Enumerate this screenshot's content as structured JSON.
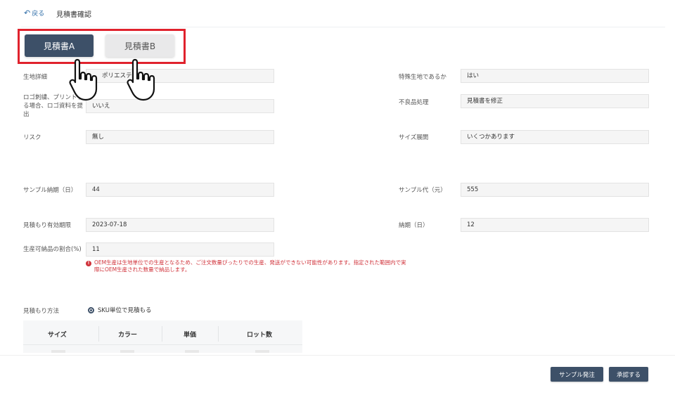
{
  "header": {
    "back_icon": "undo-arrow-icon",
    "back_label": "戻る",
    "title": "見積書確認"
  },
  "tabs": [
    {
      "label": "見積書A",
      "active": true
    },
    {
      "label": "見積書B",
      "active": false
    }
  ],
  "annotation": {
    "highlight_color": "#e0222d",
    "pointer_icon": "pointing-hand-icon"
  },
  "form": {
    "left": [
      {
        "label": "生地詳細",
        "value": "ポリエステル"
      },
      {
        "label": "ロゴ刺繍、プリントする場合、ロゴ資料を提出",
        "value": "いいえ"
      },
      {
        "label": "リスク",
        "value": "無し"
      },
      {
        "label": "サンプル納期（日）",
        "value": "44"
      },
      {
        "label": "見積もり有効期限",
        "value": "2023-07-18"
      },
      {
        "label": "生産可納品の割合(%)",
        "value": "11"
      }
    ],
    "right": [
      {
        "label": "特殊生地であるか",
        "value": "はい"
      },
      {
        "label": "不良品処理",
        "value": "見積書を修正"
      },
      {
        "label": "サイズ展開",
        "value": "いくつかあります"
      },
      {
        "label": "サンプル代（元）",
        "value": "555"
      },
      {
        "label": "納期（日）",
        "value": "12"
      }
    ],
    "warning": "OEM生産は生地単位での生産となるため、ご注文数量ぴったりでの生産、発送ができない可能性があります。指定された範囲内で実際にOEM生産された数量で納品します。",
    "warning_icon": "exclamation-circle-icon"
  },
  "estimate_method": {
    "label": "見積もり方法",
    "option": "SKU単位で見積もる",
    "selected": true
  },
  "table": {
    "headers": [
      "サイズ",
      "カラー",
      "単価",
      "ロット数"
    ]
  },
  "footer": {
    "sample_order_label": "サンプル発注",
    "approve_label": "承認する"
  },
  "colors": {
    "primary": "#3d5068",
    "link": "#2f6ea8",
    "warning": "#d0323a"
  }
}
